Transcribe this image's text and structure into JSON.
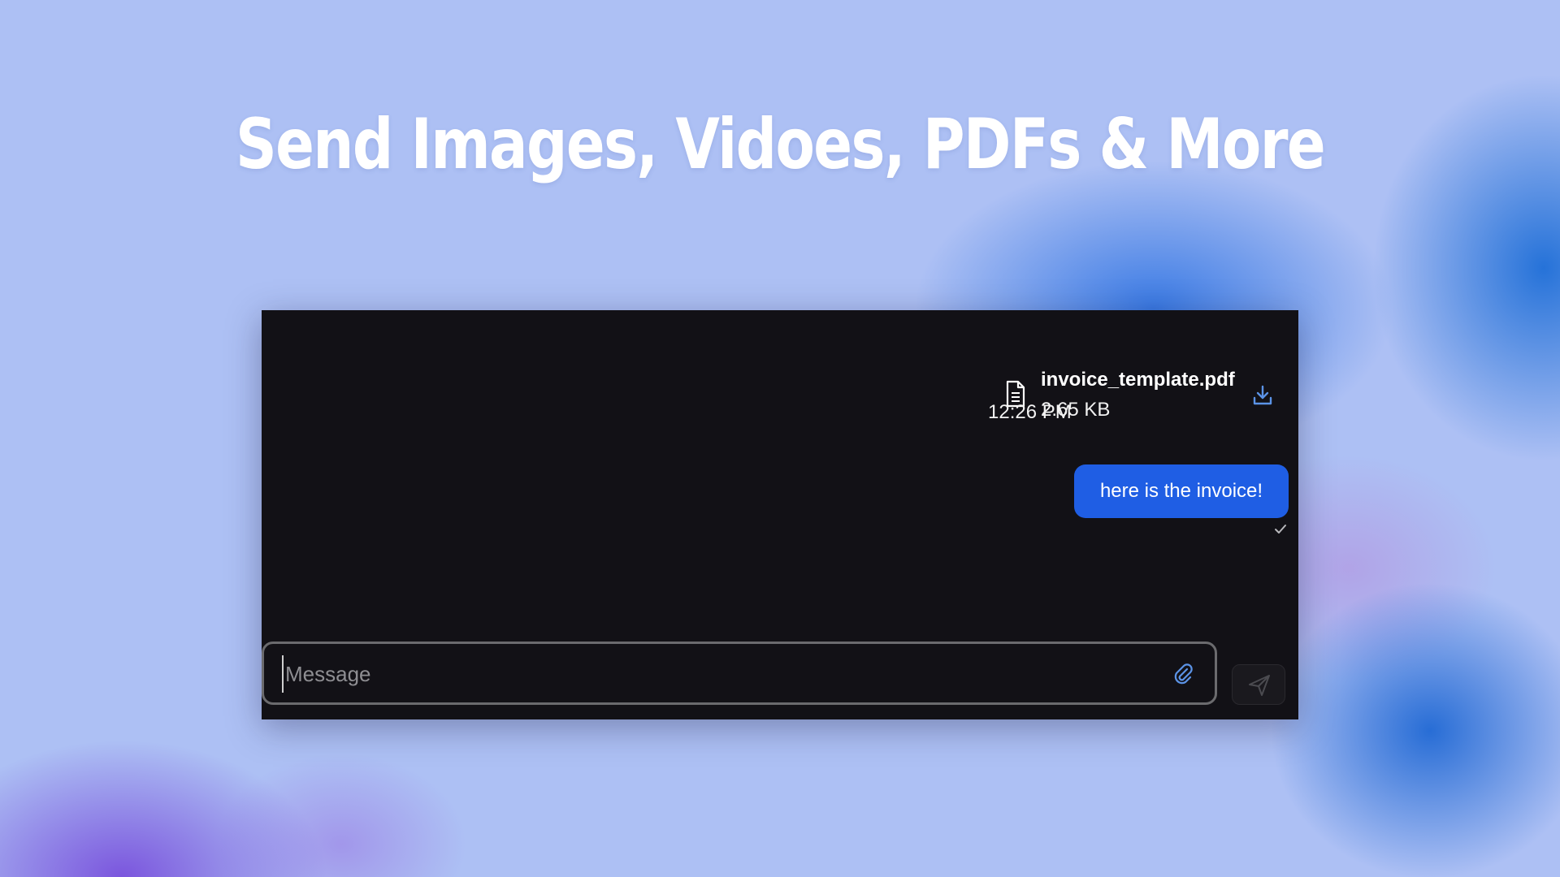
{
  "headline": "Send Images, Vidoes, PDFs & More",
  "chat": {
    "file": {
      "name": "invoice_template.pdf",
      "size": "2.65 KB",
      "time": "12:26 PM",
      "icon": "document-icon",
      "download_icon": "download-icon"
    },
    "message": {
      "text": "here is the invoice!",
      "status_icon": "check-icon",
      "bubble_color": "#1f5ee4"
    },
    "composer": {
      "placeholder": "Message",
      "value": "",
      "attach_icon": "paperclip-icon",
      "send_icon": "send-icon"
    }
  },
  "colors": {
    "background": "#adc0f4",
    "panel": "#121116",
    "accent": "#1f5ee4"
  }
}
